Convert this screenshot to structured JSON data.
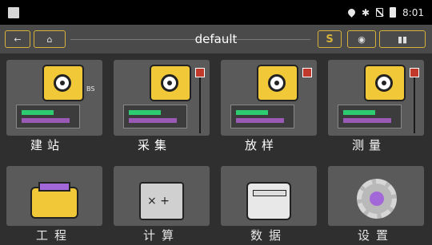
{
  "status_bar": {
    "time": "8:01",
    "icons": [
      "location-icon",
      "bluetooth-icon",
      "no-sim-icon",
      "battery-icon"
    ]
  },
  "toolbar": {
    "title": "default",
    "s_label": "S",
    "gps_icon": "satellite-icon",
    "bat_icon": "battery-status-icon"
  },
  "grid": {
    "row1": [
      {
        "label": "建站",
        "icon": "station-setup-icon",
        "badge": "BS"
      },
      {
        "label": "采集",
        "icon": "collect-icon",
        "badge": ""
      },
      {
        "label": "放样",
        "icon": "stakeout-icon",
        "badge": ""
      },
      {
        "label": "测量",
        "icon": "measure-icon",
        "badge": ""
      }
    ],
    "row2": [
      {
        "label": "工程",
        "icon": "toolbox-icon"
      },
      {
        "label": "计算",
        "icon": "calculator-icon"
      },
      {
        "label": "数据",
        "icon": "database-icon"
      },
      {
        "label": "设置",
        "icon": "gear-icon"
      }
    ]
  },
  "colors": {
    "accent": "#f0c838",
    "status_bg": "#000000",
    "toolbar_bg": "#4a4a4a",
    "body_bg": "#2f2f2f"
  }
}
